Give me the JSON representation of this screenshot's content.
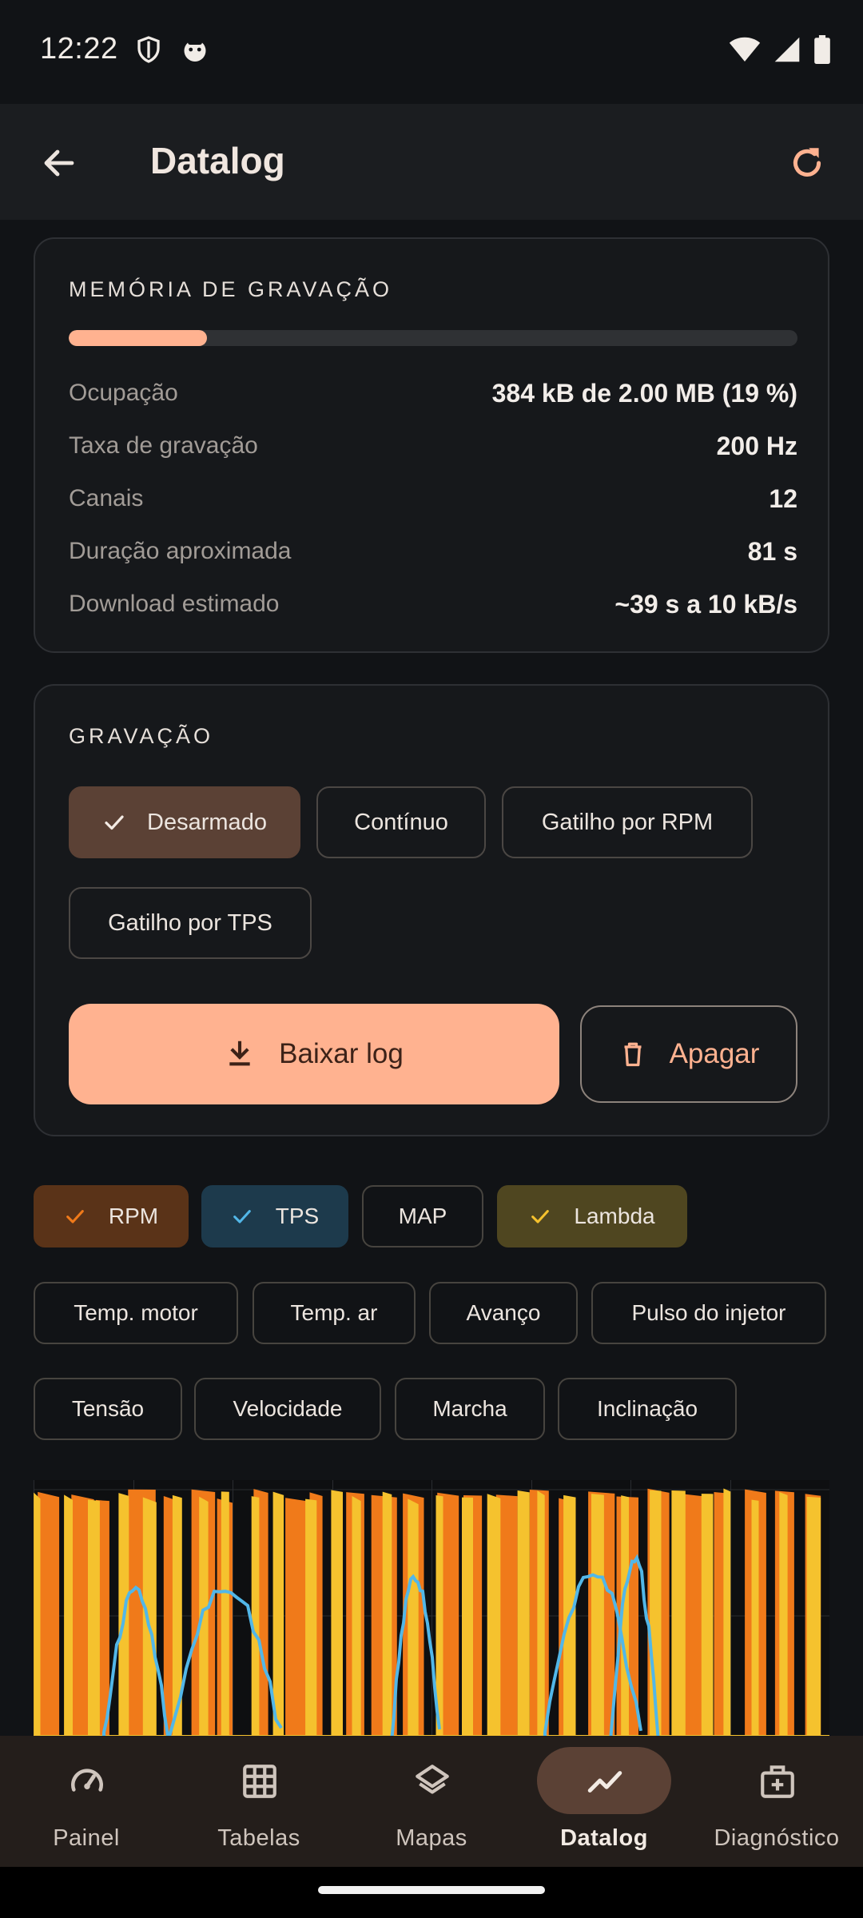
{
  "status_bar": {
    "time": "12:22"
  },
  "app_bar": {
    "title": "Datalog"
  },
  "memory": {
    "title": "MEMÓRIA DE GRAVAÇÃO",
    "usage_fraction": 0.19,
    "rows": [
      {
        "label": "Ocupação",
        "value": "384 kB de 2.00 MB (19 %)"
      },
      {
        "label": "Taxa de gravação",
        "value": "200 Hz"
      },
      {
        "label": "Canais",
        "value": "12"
      },
      {
        "label": "Duração aproximada",
        "value": "81 s"
      },
      {
        "label": "Download estimado",
        "value": "~39 s a 10 kB/s"
      }
    ]
  },
  "recording": {
    "title": "GRAVAÇÃO",
    "modes": [
      {
        "label": "Desarmado",
        "selected": true
      },
      {
        "label": "Contínuo",
        "selected": false
      },
      {
        "label": "Gatilho por RPM",
        "selected": false
      },
      {
        "label": "Gatilho por TPS",
        "selected": false
      }
    ],
    "download_label": "Baixar log",
    "delete_label": "Apagar"
  },
  "channels": [
    {
      "label": "RPM",
      "selected": true,
      "color": "#f07a1a",
      "bg": "#5a3318"
    },
    {
      "label": "TPS",
      "selected": true,
      "color": "#52b7e8",
      "bg": "#1d3a4c"
    },
    {
      "label": "MAP",
      "selected": false
    },
    {
      "label": "Lambda",
      "selected": true,
      "color": "#f5c22e",
      "bg": "#4f4620"
    },
    {
      "label": "Temp. motor",
      "selected": false
    },
    {
      "label": "Temp. ar",
      "selected": false
    },
    {
      "label": "Avanço",
      "selected": false
    },
    {
      "label": "Pulso do injetor",
      "selected": false
    },
    {
      "label": "Tensão",
      "selected": false
    },
    {
      "label": "Velocidade",
      "selected": false
    },
    {
      "label": "Marcha",
      "selected": false
    },
    {
      "label": "Inclinação",
      "selected": false
    }
  ],
  "nav": [
    {
      "label": "Painel",
      "icon": "gauge-icon",
      "active": false
    },
    {
      "label": "Tabelas",
      "icon": "grid-icon",
      "active": false
    },
    {
      "label": "Mapas",
      "icon": "layers-icon",
      "active": false
    },
    {
      "label": "Datalog",
      "icon": "chart-line-icon",
      "active": true
    },
    {
      "label": "Diagnóstico",
      "icon": "medical-kit-icon",
      "active": false
    }
  ],
  "colors": {
    "accent": "#ffb290",
    "rpm": "#f07a1a",
    "tps": "#52b7e8",
    "lambda": "#f5c22e"
  }
}
